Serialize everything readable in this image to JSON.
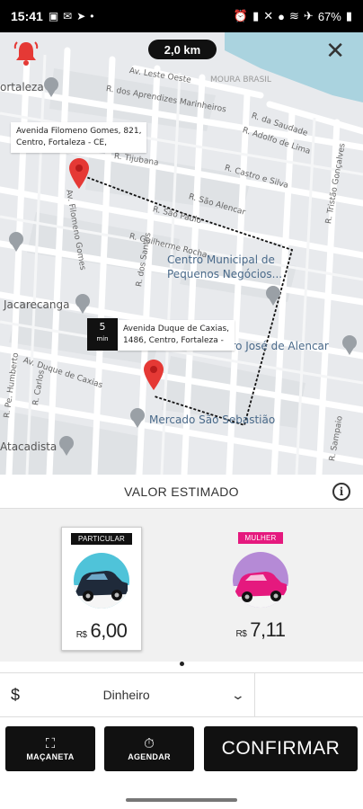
{
  "status_bar": {
    "time": "15:41",
    "battery": "67%",
    "left_icons": [
      "gallery-icon",
      "mail-icon",
      "telegram-icon",
      "dot-icon"
    ],
    "right_icons": [
      "alarm-icon",
      "signal-icon",
      "mute-icon",
      "location-icon",
      "wifi-icon",
      "airplane-icon",
      "battery-icon"
    ]
  },
  "map": {
    "distance": "2,0 km",
    "streets": {
      "leste_oeste": "Av. Leste Oeste",
      "aprendizes": "R. dos Aprendizes Marinheiros",
      "moura_brasil": "MOURA BRASIL",
      "saudade": "R. da Saudade",
      "adolfo_lima": "R. Adolfo de Lima",
      "tijubana": "R. Tijubana",
      "castro_silva": "R. Castro e Silva",
      "sao_alencar": "R. São Alencar",
      "sao_paulo": "R. São Paulo",
      "gomes": "Av. Filomeno Gomes",
      "guilherme_rocha": "R. Guilherme Rocha",
      "santos": "R. dos Santos",
      "tristao": "R. Tristão Gonçalves",
      "duque_caxias": "Av. Duque de Caxias",
      "pe_humberto": "R. Pe. Humberto",
      "r_carlos": "R. Carlos",
      "r_sampaio": "R. Sampaio",
      "fortaleza": "ortaleza"
    },
    "pois": {
      "centro_municipal": "Centro Municipal de",
      "centro_municipal_2": "Pequenos Negócios...",
      "jacarecanga": "Jacarecanga",
      "teatro": "eatro José de Alencar",
      "mercado": "Mercado São Sebastião",
      "atacadista": "Atacadista"
    },
    "origin_address_1": "Avenida Filomeno Gomes, 821,",
    "origin_address_2": "Centro, Fortaleza - CE,",
    "dest_address_1": "Avenida Duque de Caxias,",
    "dest_address_2": "1486, Centro, Fortaleza -",
    "eta_value": "5",
    "eta_unit": "min"
  },
  "estimate": {
    "title": "VALOR ESTIMADO",
    "info_icon": "i"
  },
  "options": [
    {
      "tag": "PARTICULAR",
      "currency": "R$",
      "price": "6,00",
      "tag_color": "#111111",
      "selected": true
    },
    {
      "tag": "MULHER",
      "currency": "R$",
      "price": "7,11",
      "tag_color": "#e5197e",
      "selected": false
    }
  ],
  "payment": {
    "currency_symbol": "$",
    "method": "Dinheiro",
    "chevron": "⌄"
  },
  "buttons": {
    "macaneta": "MAÇANETA",
    "agendar": "AGENDAR",
    "confirmar": "CONFIRMAR"
  },
  "colors": {
    "pin": "#e53935",
    "accent_pink": "#e5197e",
    "button_bg": "#111111",
    "water": "#aad3df"
  }
}
